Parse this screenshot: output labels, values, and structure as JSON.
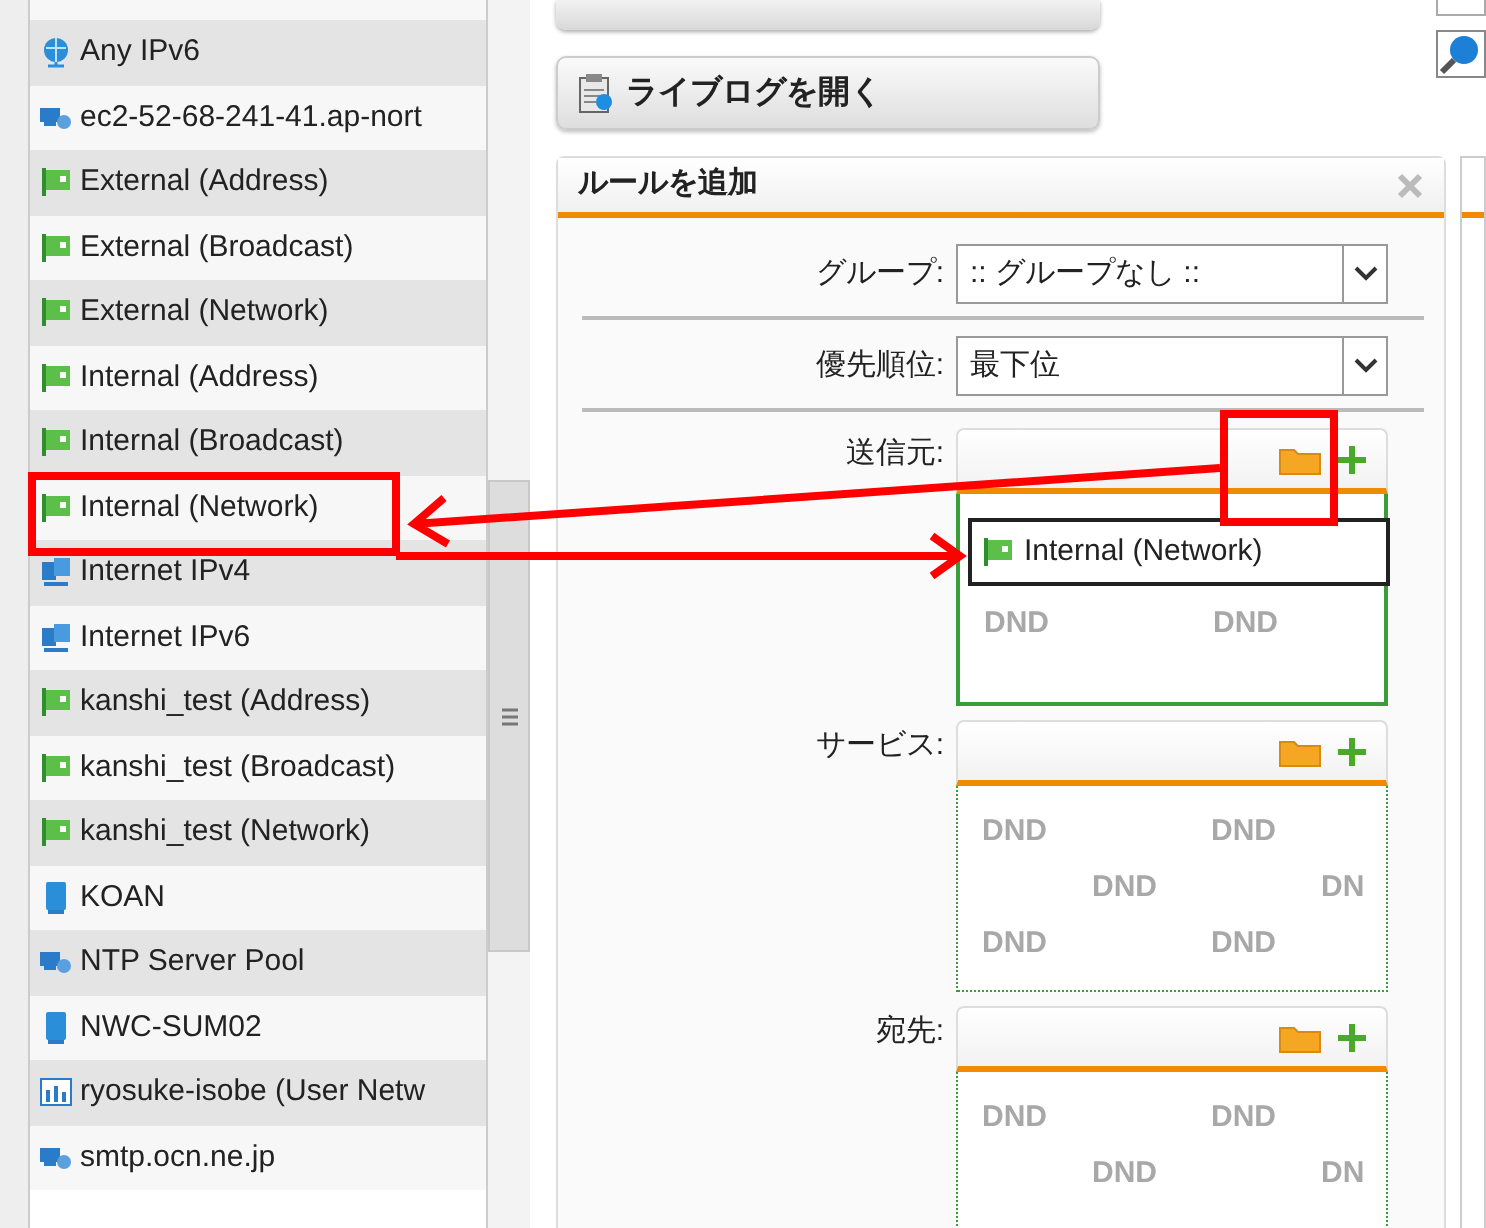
{
  "sidebar": {
    "items": [
      {
        "label": "Any IPv6",
        "kind": "globe"
      },
      {
        "label": "ec2-52-68-241-41.ap-nort",
        "kind": "host"
      },
      {
        "label": "External (Address)",
        "kind": "flag"
      },
      {
        "label": "External (Broadcast)",
        "kind": "flag"
      },
      {
        "label": "External (Network)",
        "kind": "flag"
      },
      {
        "label": "Internal (Address)",
        "kind": "flag"
      },
      {
        "label": "Internal (Broadcast)",
        "kind": "flag"
      },
      {
        "label": "Internal (Network)",
        "kind": "flag"
      },
      {
        "label": "Internet IPv4",
        "kind": "network"
      },
      {
        "label": "Internet IPv6",
        "kind": "network"
      },
      {
        "label": "kanshi_test (Address)",
        "kind": "flag"
      },
      {
        "label": "kanshi_test (Broadcast)",
        "kind": "flag"
      },
      {
        "label": "kanshi_test (Network)",
        "kind": "flag"
      },
      {
        "label": "KOAN",
        "kind": "server"
      },
      {
        "label": "NTP Server Pool",
        "kind": "host"
      },
      {
        "label": "NWC-SUM02",
        "kind": "server"
      },
      {
        "label": "ryosuke-isobe (User Netw",
        "kind": "usernet"
      },
      {
        "label": "smtp.ocn.ne.jp",
        "kind": "host"
      }
    ]
  },
  "toolbar": {
    "live_log_button": "ライブログを開く"
  },
  "panel": {
    "title": "ルールを追加",
    "selects": [
      {
        "label": "グループ:",
        "value": ":: グループなし ::"
      },
      {
        "label": "優先順位:",
        "value": "最下位"
      }
    ],
    "zones": [
      {
        "label": "送信元:",
        "highlighted": true,
        "items": [
          {
            "label": "Internal (Network)",
            "kind": "flag"
          }
        ],
        "pattern": [
          [
            "DND",
            "DND"
          ]
        ]
      },
      {
        "label": "サービス:",
        "highlighted": false,
        "pattern": [
          [
            "DND",
            "DND"
          ],
          [
            "DND",
            "DN"
          ],
          [
            "DND",
            "DND"
          ]
        ]
      },
      {
        "label": "宛先:",
        "highlighted": false,
        "pattern": [
          [
            "DND",
            "DND"
          ],
          [
            "DND",
            "DN"
          ]
        ]
      }
    ]
  }
}
